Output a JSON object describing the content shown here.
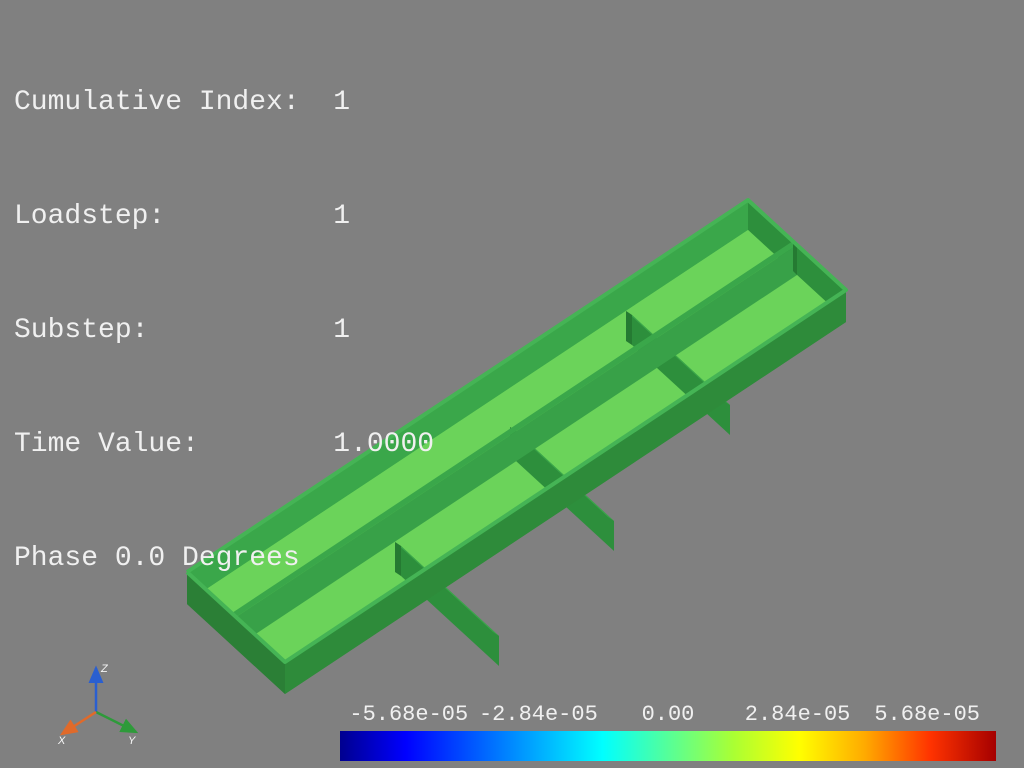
{
  "info": {
    "rows": [
      {
        "label": "Cumulative Index:  ",
        "value": "1"
      },
      {
        "label": "Loadstep:          ",
        "value": "1"
      },
      {
        "label": "Substep:           ",
        "value": "1"
      },
      {
        "label": "Time Value:        ",
        "value": "1.0000"
      },
      {
        "label": "Phase 0.0 Degrees",
        "value": ""
      }
    ]
  },
  "axes": {
    "x": "X",
    "y": "Y",
    "z": "Z"
  },
  "colorbar": {
    "ticks": [
      "-5.68e-05",
      "-2.84e-05",
      "0.00",
      "2.84e-05",
      "5.68e-05"
    ]
  },
  "model": {
    "description": "Rectangular shallow tray with 4×2 internal compartments, uniform green field",
    "outer_dark": "#2e8b3a",
    "outer_mid": "#38a148",
    "floor_light": "#6bd35a",
    "wall_partition": "#2d8f3c",
    "wall_top": "#3aa74a"
  }
}
